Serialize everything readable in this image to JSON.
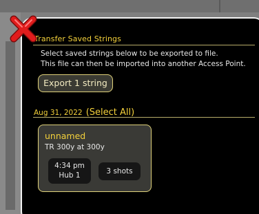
{
  "colors": {
    "accent_yellow": "#f4d13b",
    "card_border": "#e0d27a",
    "modal_bg": "#000000",
    "modal_border": "#f2f2f2",
    "close_red": "#e11d1d"
  },
  "dialog": {
    "close_icon": "close-x-icon",
    "section_title": "Transfer Saved Strings",
    "description_line1": "Select saved strings below to be exported to file.",
    "description_line2": "This file can then be imported into another Access Point.",
    "export_button_label": "Export 1 string"
  },
  "groups": [
    {
      "date": "Aug 31, 2022",
      "select_all_label": "(Select All)",
      "items": [
        {
          "name": "unnamed",
          "subtitle": "TR 300y at 300y",
          "time": "4:34 pm",
          "hub": "Hub 1",
          "shots": "3 shots"
        }
      ]
    }
  ]
}
